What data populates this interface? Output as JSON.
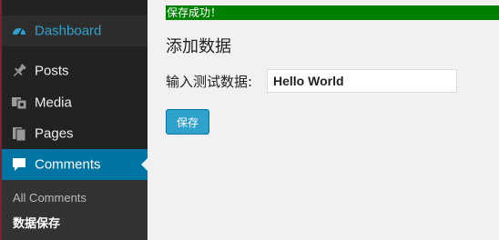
{
  "sidebar": {
    "items": [
      {
        "label": "Dashboard",
        "icon": "dashboard-icon"
      },
      {
        "label": "Posts",
        "icon": "pin-icon"
      },
      {
        "label": "Media",
        "icon": "media-icon"
      },
      {
        "label": "Pages",
        "icon": "pages-icon"
      },
      {
        "label": "Comments",
        "icon": "comment-icon"
      }
    ],
    "submenu": [
      {
        "label": "All Comments"
      },
      {
        "label": "数据保存"
      }
    ]
  },
  "notice": {
    "text": "保存成功！"
  },
  "main": {
    "title": "添加数据",
    "field_label": "输入测试数据:",
    "field_value": "Hello World",
    "save_label": "保存"
  },
  "colors": {
    "sidebar_bg": "#222222",
    "active_bg": "#0074a2",
    "accent": "#2ea2cc",
    "notice_bg": "#008000"
  }
}
